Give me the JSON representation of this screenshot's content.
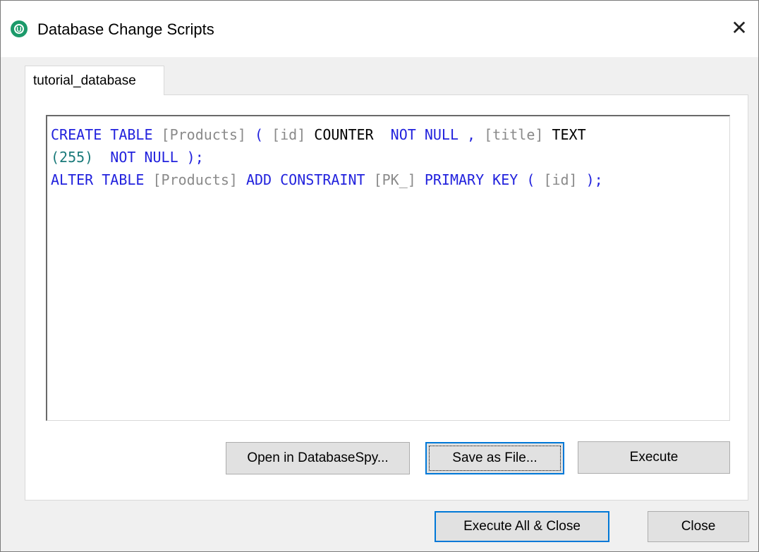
{
  "window": {
    "title": "Database Change Scripts",
    "close_symbol": "✕"
  },
  "tabs": [
    {
      "label": "tutorial_database",
      "selected": true
    }
  ],
  "editor": {
    "lines": [
      [
        {
          "text": "CREATE TABLE ",
          "kind": "keyword"
        },
        {
          "text": "[Products]",
          "kind": "identifier"
        },
        {
          "text": " ( ",
          "kind": "keyword"
        },
        {
          "text": "[id]",
          "kind": "identifier"
        },
        {
          "text": " COUNTER ",
          "kind": "type"
        },
        {
          "text": " NOT NULL , ",
          "kind": "keyword"
        },
        {
          "text": "[title]",
          "kind": "identifier"
        },
        {
          "text": " TEXT",
          "kind": "type"
        }
      ],
      [
        {
          "text": "(255)",
          "kind": "number"
        },
        {
          "text": "  NOT NULL );",
          "kind": "keyword"
        }
      ],
      [
        {
          "text": "ALTER TABLE ",
          "kind": "keyword"
        },
        {
          "text": "[Products]",
          "kind": "identifier"
        },
        {
          "text": " ADD CONSTRAINT ",
          "kind": "keyword"
        },
        {
          "text": "[PK_]",
          "kind": "identifier"
        },
        {
          "text": " PRIMARY KEY ( ",
          "kind": "keyword"
        },
        {
          "text": "[id]",
          "kind": "identifier"
        },
        {
          "text": " );",
          "kind": "keyword"
        }
      ]
    ]
  },
  "panel_buttons": {
    "open_in_databasespy": "Open in DatabaseSpy...",
    "save_as_file": "Save as File...",
    "execute": "Execute"
  },
  "footer_buttons": {
    "execute_all_close": "Execute All & Close",
    "close": "Close"
  },
  "colors": {
    "keyword": "#2222dd",
    "identifier": "#8a8a8a",
    "type": "#000000",
    "number": "#1a7a7a",
    "focus_border": "#0078d7",
    "app_icon": "#1b9a6a"
  }
}
